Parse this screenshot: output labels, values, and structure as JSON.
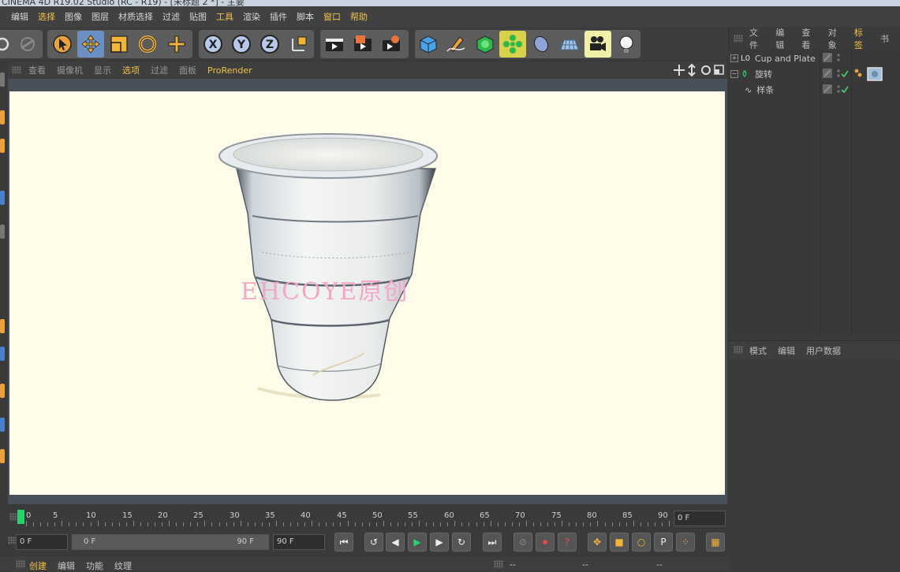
{
  "window": {
    "title": "CINEMA 4D R19.02 Studio (RC - R19) - [未标题 2 *] - 主要"
  },
  "menu": [
    {
      "label": "编辑",
      "highlight": false
    },
    {
      "label": "选择",
      "highlight": true
    },
    {
      "label": "图像",
      "highlight": false
    },
    {
      "label": "图层",
      "highlight": false
    },
    {
      "label": "材质选择",
      "highlight": false
    },
    {
      "label": "过滤",
      "highlight": false
    },
    {
      "label": "贴图",
      "highlight": false
    },
    {
      "label": "工具",
      "highlight": true
    },
    {
      "label": "渲染",
      "highlight": false
    },
    {
      "label": "插件",
      "highlight": false
    },
    {
      "label": "脚本",
      "highlight": false
    },
    {
      "label": "窗口",
      "highlight": true
    },
    {
      "label": "帮助",
      "highlight": true
    }
  ],
  "toolbar": {
    "axis_x": "X",
    "axis_y": "Y",
    "axis_z": "Z",
    "icons": [
      "undo-icon",
      "redo-icon",
      "select-arrow-icon",
      "move-icon",
      "scale-icon",
      "rotate-icon",
      "add-icon",
      "axis-x-icon",
      "axis-y-icon",
      "axis-z-icon",
      "coordinate-system-icon",
      "render-view-icon",
      "render-picture-viewer-icon",
      "render-settings-icon",
      "cube-icon",
      "pen-icon",
      "subdivision-icon",
      "array-icon",
      "deformer-icon",
      "floor-icon",
      "camera-icon",
      "light-icon"
    ]
  },
  "viewport": {
    "menu": [
      {
        "label": "查看",
        "selected": false
      },
      {
        "label": "摄像机",
        "selected": false
      },
      {
        "label": "显示",
        "selected": false
      },
      {
        "label": "选项",
        "selected": true
      },
      {
        "label": "过滤",
        "selected": false
      },
      {
        "label": "面板",
        "selected": false
      },
      {
        "label": "ProRender",
        "selected": true
      }
    ],
    "background_color": "#fffce9",
    "watermark": "EHCOYE原创"
  },
  "timeline": {
    "ticks": [
      "0",
      "5",
      "10",
      "15",
      "20",
      "25",
      "30",
      "35",
      "40",
      "45",
      "50",
      "55",
      "60",
      "65",
      "70",
      "75",
      "80",
      "85",
      "90"
    ],
    "current_frame": "0 F",
    "start_field": "0 F",
    "range_start": "0 F",
    "range_end": "90 F",
    "end_field": "90 F"
  },
  "objects_panel": {
    "menu": [
      {
        "label": "文件",
        "active": false
      },
      {
        "label": "编辑",
        "active": false
      },
      {
        "label": "查看",
        "active": false
      },
      {
        "label": "对象",
        "active": false
      },
      {
        "label": "标签",
        "active": true
      },
      {
        "label": "书",
        "active": false
      }
    ],
    "items": [
      {
        "name": "Cup and Plate",
        "icon": "null-object-icon"
      },
      {
        "name": "旋转",
        "icon": "lathe-icon"
      },
      {
        "name": "样条",
        "icon": "spline-icon"
      }
    ]
  },
  "attributes_panel": {
    "menu": [
      "模式",
      "编辑",
      "用户数据"
    ]
  },
  "bottom": {
    "tabs": [
      "创建",
      "编辑",
      "功能",
      "纹理"
    ],
    "coord_placeholders": [
      "--",
      "--",
      "--"
    ]
  },
  "colors": {
    "accent": "#f2c24a",
    "playhead": "#27d46a",
    "ui_bg": "#3a3a3a"
  }
}
